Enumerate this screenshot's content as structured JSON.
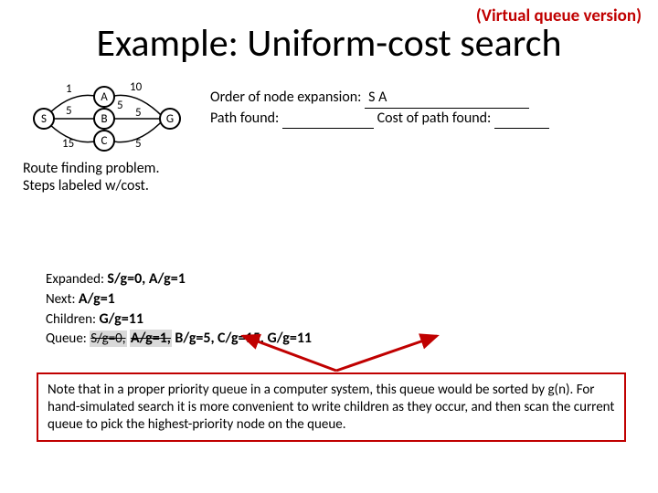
{
  "header": {
    "subtitle": "(Virtual queue version)",
    "title": "Example: Uniform-cost search"
  },
  "graph": {
    "nodes": {
      "S": "S",
      "A": "A",
      "B": "B",
      "C": "C",
      "G": "G"
    },
    "edges": {
      "SA": "1",
      "SB": "5",
      "SC": "15",
      "AG": "10",
      "AB": "5",
      "BG": "5",
      "CG": "5"
    }
  },
  "answers": {
    "order_label": "Order of node expansion:",
    "order_value": "   S A",
    "path_label": "Path found:",
    "cost_label": "Cost of path found:"
  },
  "caption": {
    "l1": "Route finding problem.",
    "l2": "Steps labeled w/cost."
  },
  "trace": {
    "expanded_label": "Expanded:",
    "expanded_val": "S/g=0, A/g=1",
    "next_label": "Next:",
    "next_val": "A/g=1",
    "children_label": "Children:",
    "children_val": "G/g=11",
    "queue_label": "Queue:",
    "q1": "S/g=0,",
    "q2": "A/g=1,",
    "q3": "B/g=5,",
    "q4": "C/g=15, G/g=11"
  },
  "note": {
    "text": "Note that in a proper priority queue in a computer system, this queue would be sorted by g(n). For hand-simulated search it is more convenient to write children as they occur, and then scan the current queue to pick the highest-priority node on the queue."
  }
}
